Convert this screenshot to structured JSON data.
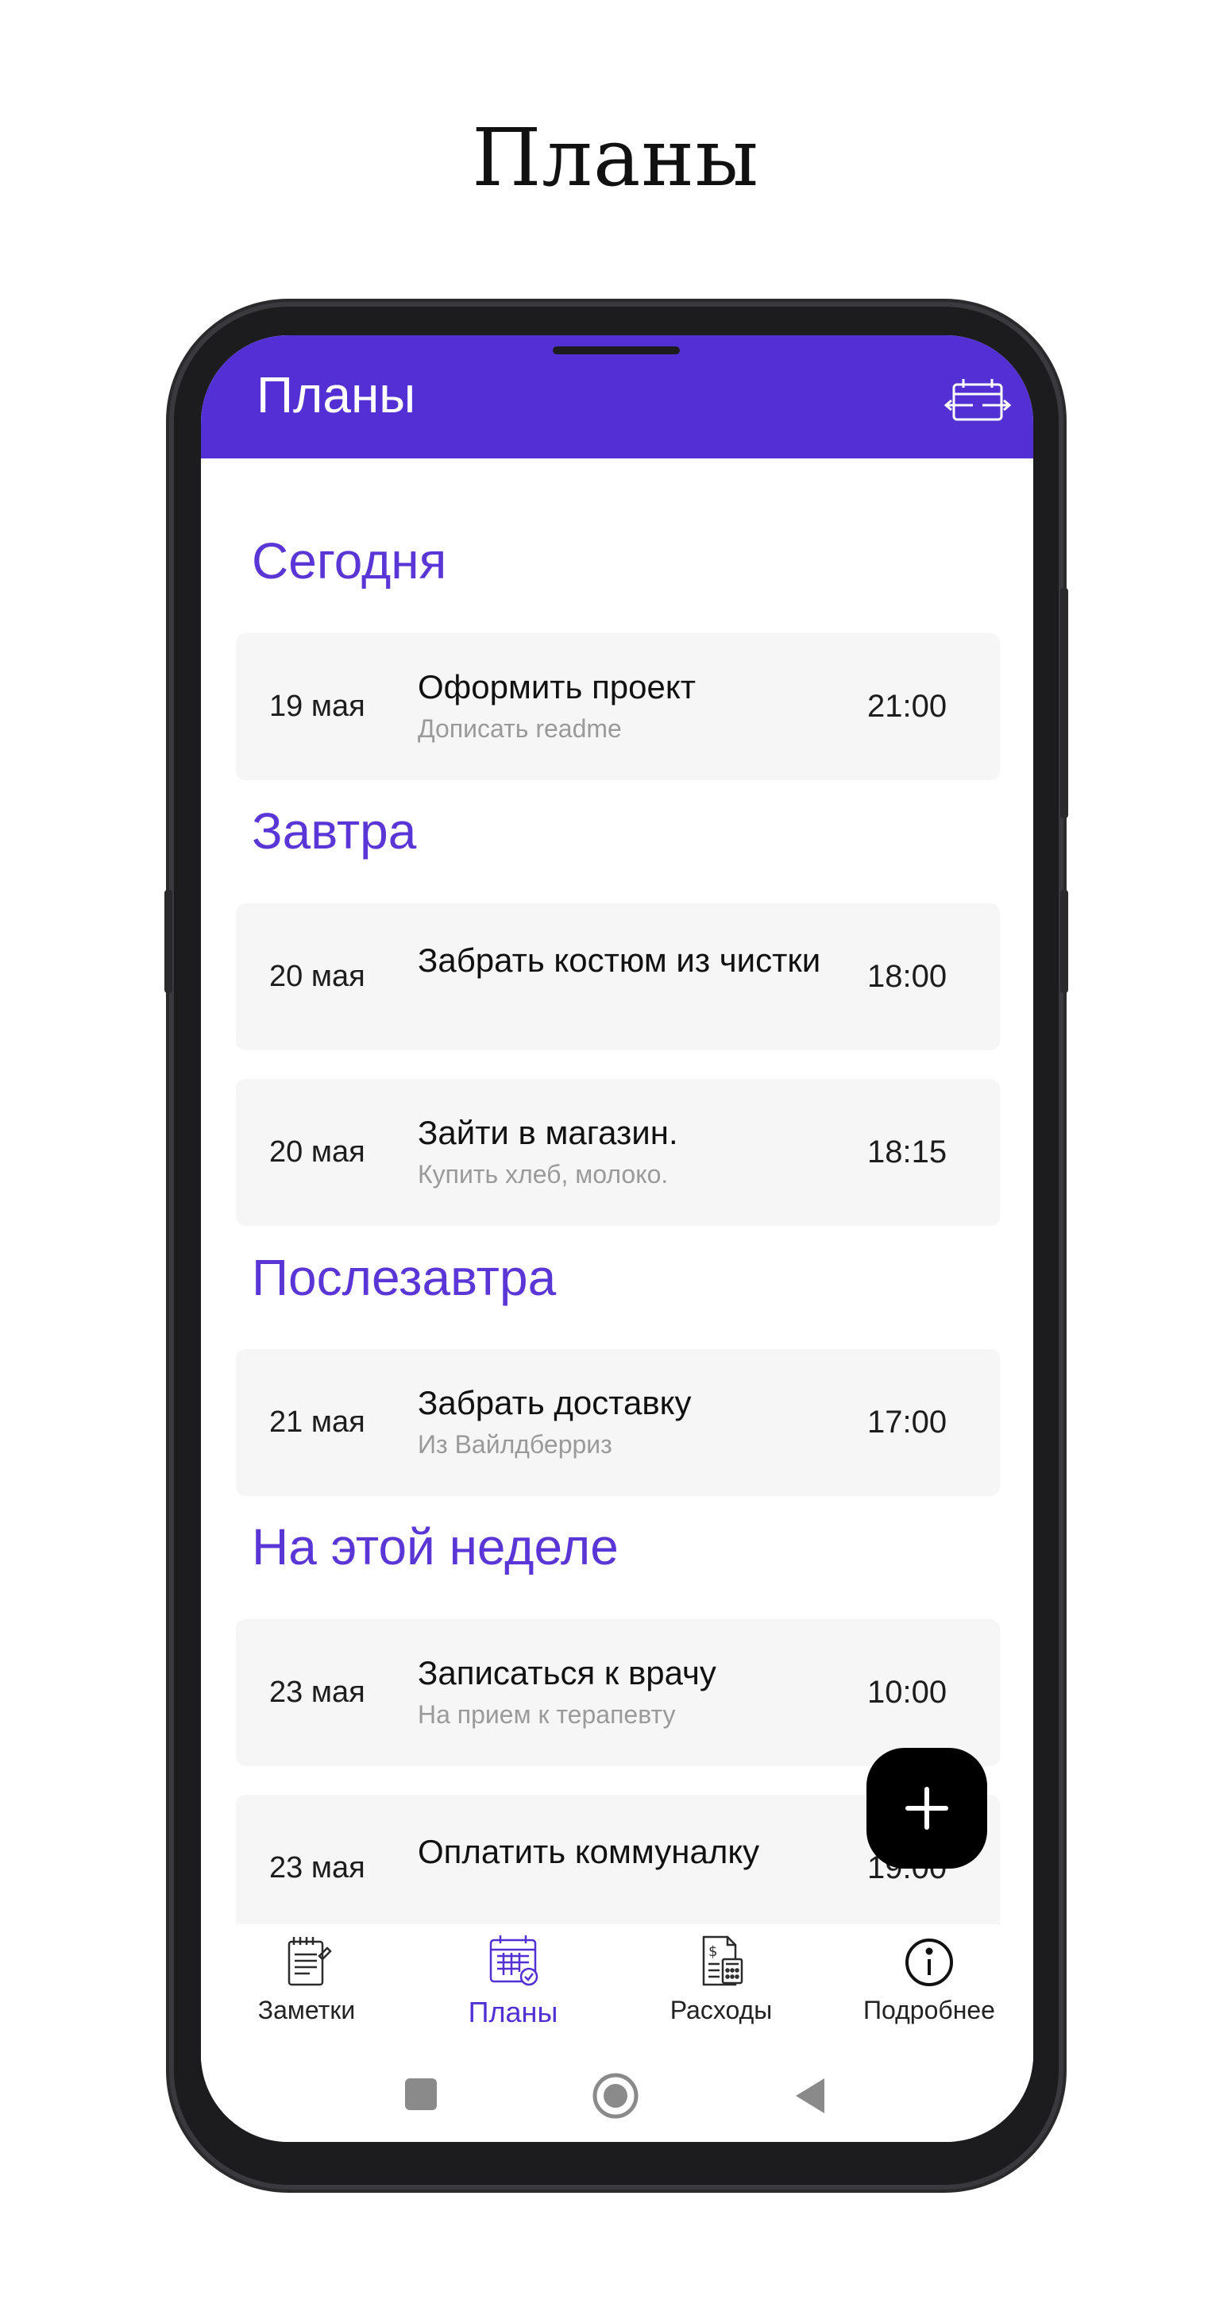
{
  "page": {
    "heading": "Планы"
  },
  "app": {
    "title": "Планы",
    "accent": "#5230D3",
    "header_icon": "calendar-swap-icon"
  },
  "sections": [
    {
      "title": "Сегодня",
      "items": [
        {
          "date": "19 мая",
          "title": "Оформить проект",
          "subtitle": "Дописать readme",
          "time": "21:00"
        }
      ]
    },
    {
      "title": "Завтра",
      "items": [
        {
          "date": "20 мая",
          "title": "Забрать костюм из чистки",
          "subtitle": "",
          "time": "18:00"
        },
        {
          "date": "20 мая",
          "title": "Зайти в магазин.",
          "subtitle": "Купить хлеб, молоко.",
          "time": "18:15"
        }
      ]
    },
    {
      "title": "Послезавтра",
      "items": [
        {
          "date": "21 мая",
          "title": "Забрать доставку",
          "subtitle": "Из Вайлдберриз",
          "time": "17:00"
        }
      ]
    },
    {
      "title": "На этой неделе",
      "items": [
        {
          "date": "23 мая",
          "title": "Записаться к врачу",
          "subtitle": "На прием к терапевту",
          "time": "10:00"
        },
        {
          "date": "23 мая",
          "title": "Оплатить коммуналку",
          "subtitle": "",
          "time": "19:00"
        }
      ]
    }
  ],
  "fab": {
    "icon": "plus-icon"
  },
  "bottom_nav": [
    {
      "label": "Заметки",
      "icon": "notes-icon",
      "active": false
    },
    {
      "label": "Планы",
      "icon": "calendar-icon",
      "active": true
    },
    {
      "label": "Расходы",
      "icon": "expenses-icon",
      "active": false
    },
    {
      "label": "Подробнее",
      "icon": "info-icon",
      "active": false
    }
  ],
  "system_nav": [
    "recents-icon",
    "home-icon",
    "back-icon"
  ]
}
